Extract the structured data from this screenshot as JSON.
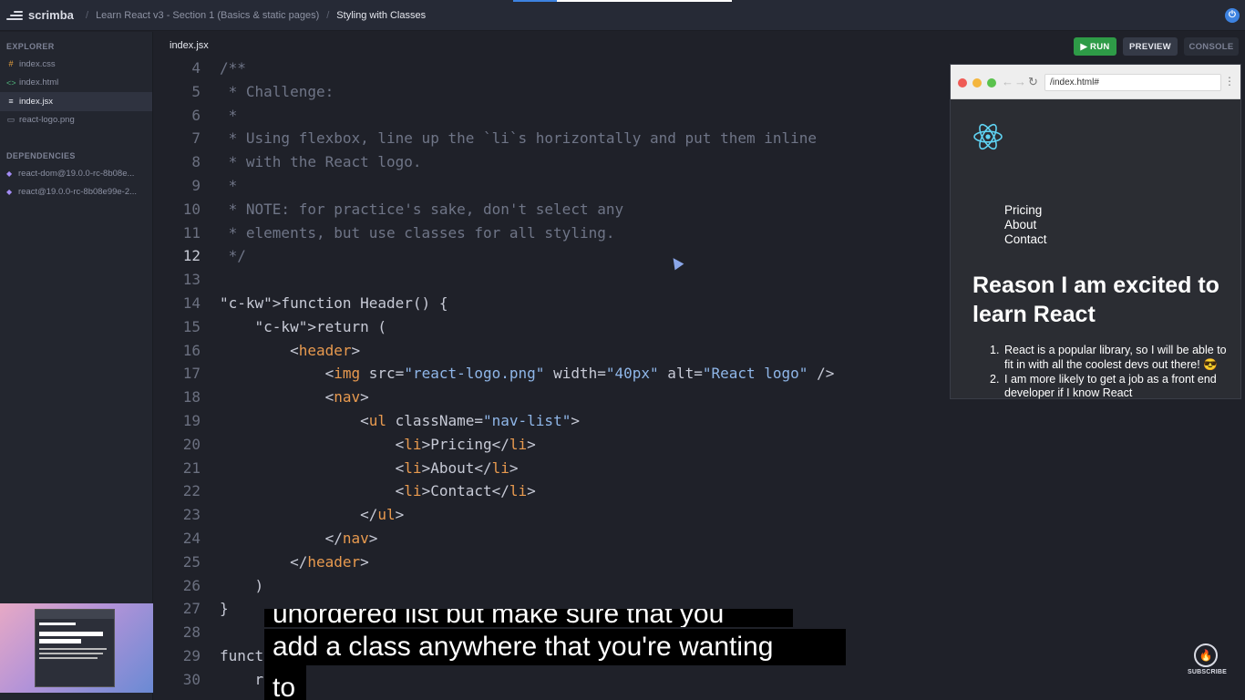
{
  "topbar": {
    "brand": "scrimba",
    "course": "Learn React v3 - Section 1 (Basics & static pages)",
    "lesson": "Styling with Classes"
  },
  "sidebar": {
    "explorer_title": "EXPLORER",
    "files": [
      {
        "name": "index.css",
        "icon": "#",
        "color": "#e8a13d"
      },
      {
        "name": "index.html",
        "icon": "<>",
        "color": "#4fb37a"
      },
      {
        "name": "index.jsx",
        "icon": "≡",
        "color": "#c7cad6"
      },
      {
        "name": "react-logo.png",
        "icon": "▭",
        "color": "#7c8194"
      }
    ],
    "dependencies_title": "DEPENDENCIES",
    "dependencies": [
      "react-dom@19.0.0-rc-8b08e...",
      "react@19.0.0-rc-8b08e99e-2..."
    ]
  },
  "editor": {
    "tab": "index.jsx",
    "run_label": "▶ RUN",
    "preview_label": "PREVIEW",
    "console_label": "CONSOLE",
    "current_line": 12,
    "lines": [
      {
        "n": "4",
        "t": "/**"
      },
      {
        "n": "5",
        "t": " * Challenge:"
      },
      {
        "n": "6",
        "t": " *"
      },
      {
        "n": "7",
        "t": " * Using flexbox, line up the `li`s horizontally and put them inline"
      },
      {
        "n": "8",
        "t": " * with the React logo."
      },
      {
        "n": "9",
        "t": " *"
      },
      {
        "n": "10",
        "t": " * NOTE: for practice's sake, don't select any"
      },
      {
        "n": "11",
        "t": " * elements, but use classes for all styling."
      },
      {
        "n": "12",
        "t": " */"
      },
      {
        "n": "13",
        "t": ""
      },
      {
        "n": "14",
        "t": "function Header() {"
      },
      {
        "n": "15",
        "t": "    return ("
      },
      {
        "n": "16",
        "t": "        <header>"
      },
      {
        "n": "17",
        "t": "            <img src=\"react-logo.png\" width=\"40px\" alt=\"React logo\" />"
      },
      {
        "n": "18",
        "t": "            <nav>"
      },
      {
        "n": "19",
        "t": "                <ul className=\"nav-list\">"
      },
      {
        "n": "20",
        "t": "                    <li>Pricing</li>"
      },
      {
        "n": "21",
        "t": "                    <li>About</li>"
      },
      {
        "n": "22",
        "t": "                    <li>Contact</li>"
      },
      {
        "n": "23",
        "t": "                </ul>"
      },
      {
        "n": "24",
        "t": "            </nav>"
      },
      {
        "n": "25",
        "t": "        </header>"
      },
      {
        "n": "26",
        "t": "    )"
      },
      {
        "n": "27",
        "t": "}"
      },
      {
        "n": "28",
        "t": ""
      },
      {
        "n": "29",
        "t": "funct"
      },
      {
        "n": "30",
        "t": "    r  n ("
      }
    ]
  },
  "preview": {
    "url": "/index.html#",
    "nav_items": [
      "Pricing",
      "About",
      "Contact"
    ],
    "heading": "Reason I am excited to learn React",
    "reasons": [
      "React is a popular library, so I will be able to fit in with all the coolest devs out there! 😎",
      "I am more likely to get a job as a front end developer if I know React"
    ]
  },
  "captions": [
    "unordered list but make sure that you",
    "add a class anywhere that you're wanting",
    "to"
  ],
  "subscribe_label": "SUBSCRIBE"
}
